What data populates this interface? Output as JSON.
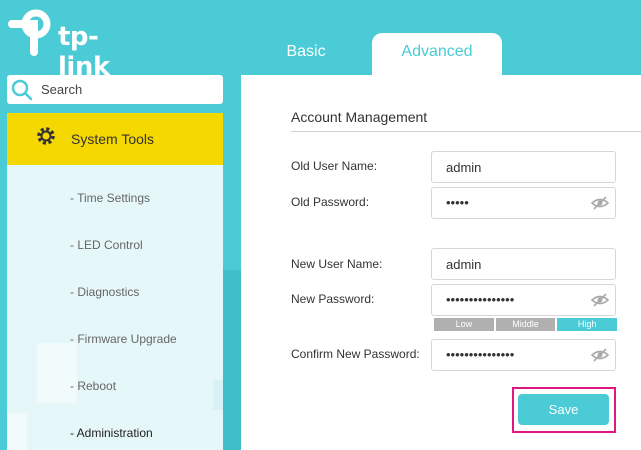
{
  "brand": {
    "logo_text": "tp-link"
  },
  "tabs": [
    {
      "label": "Basic",
      "active": false
    },
    {
      "label": "Advanced",
      "active": true
    }
  ],
  "search": {
    "placeholder": "Search"
  },
  "sidebar": {
    "section_label": "System Tools",
    "items": [
      {
        "label": "- Time Settings"
      },
      {
        "label": "- LED Control"
      },
      {
        "label": "- Diagnostics"
      },
      {
        "label": "- Firmware Upgrade"
      },
      {
        "label": "- Reboot"
      },
      {
        "label": "- Administration"
      }
    ]
  },
  "account": {
    "title": "Account Management",
    "old_user_label": "Old User Name:",
    "old_user_value": "admin",
    "old_password_label": "Old Password:",
    "old_password_value": "•••••",
    "new_user_label": "New User Name:",
    "new_user_value": "admin",
    "new_password_label": "New Password:",
    "new_password_value": "•••••••••••••••",
    "strength": {
      "low": "Low",
      "middle": "Middle",
      "high": "High",
      "level": "High"
    },
    "confirm_label": "Confirm New Password:",
    "confirm_value": "•••••••••••••••",
    "save_label": "Save"
  },
  "colors": {
    "accent": "#4acbd6",
    "section": "#f5d800",
    "highlight_frame": "#e0177f"
  }
}
